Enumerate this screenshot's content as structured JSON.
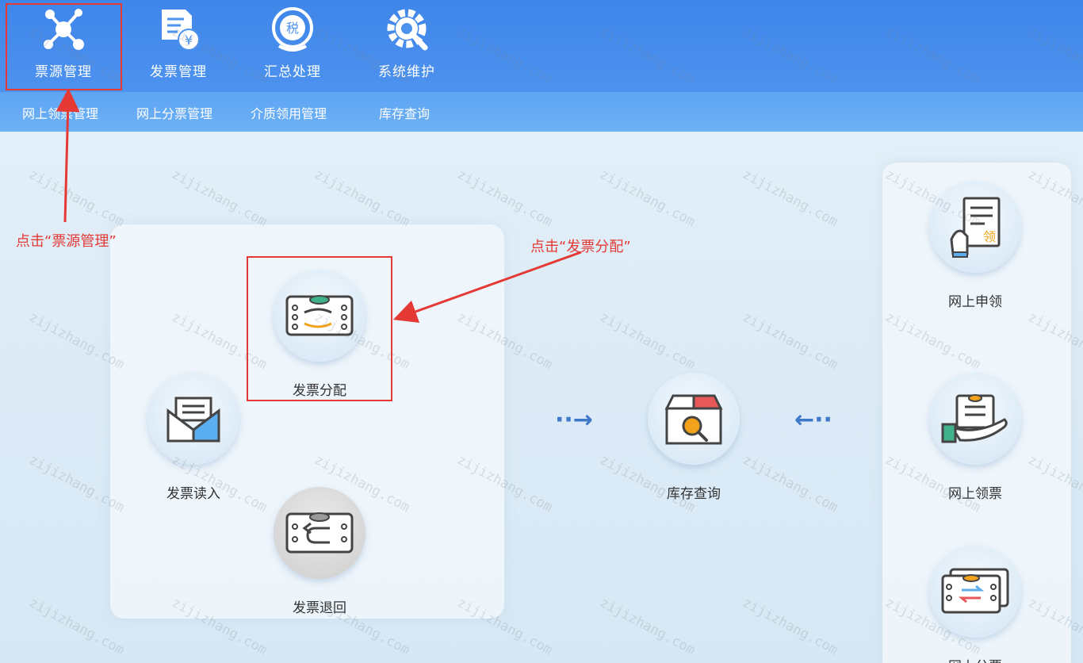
{
  "top_nav": [
    {
      "label": "票源管理",
      "icon": "network-icon"
    },
    {
      "label": "发票管理",
      "icon": "invoice-yen-icon"
    },
    {
      "label": "汇总处理",
      "icon": "tax-icon"
    },
    {
      "label": "系统维护",
      "icon": "wrench-gear-icon"
    }
  ],
  "sub_nav": [
    {
      "label": "网上领票管理"
    },
    {
      "label": "网上分票管理"
    },
    {
      "label": "介质领用管理"
    },
    {
      "label": "库存查询"
    }
  ],
  "left_panel": {
    "allocate": {
      "label": "发票分配",
      "icon": "invoice-allocate-icon"
    },
    "read_in": {
      "label": "发票读入",
      "icon": "envelope-icon"
    },
    "return": {
      "label": "发票退回",
      "icon": "invoice-return-icon"
    }
  },
  "center": {
    "inventory": {
      "label": "库存查询",
      "icon": "box-search-icon"
    },
    "arrow_right": "··→",
    "arrow_left": "←··"
  },
  "right_panel": {
    "apply": {
      "label": "网上申领",
      "icon": "apply-hand-icon"
    },
    "receive": {
      "label": "网上领票",
      "icon": "receive-hand-icon"
    },
    "split": {
      "label": "网上分票",
      "icon": "split-ticket-icon"
    }
  },
  "annotations": {
    "note1": "点击“票源管理”",
    "note2": "点击“发票分配”",
    "color": "#e53935"
  },
  "watermark_text": "zijizhang.com"
}
